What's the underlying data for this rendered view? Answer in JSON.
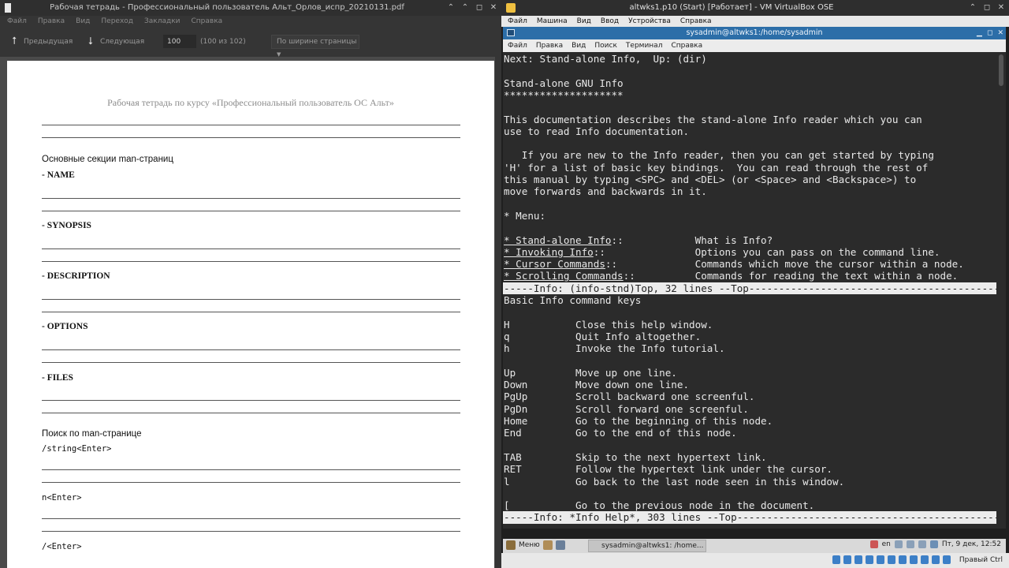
{
  "pdf": {
    "title": "Рабочая тетрадь - Профессиональный пользователь Альт_Орлов_испр_20210131.pdf",
    "menu": [
      "Файл",
      "Правка",
      "Вид",
      "Переход",
      "Закладки",
      "Справка"
    ],
    "toolbar": {
      "prev_label": "Предыдущая",
      "next_label": "Следующая",
      "page_value": "100",
      "page_count": "(100 из 102)",
      "zoom": "По ширине страницы"
    },
    "page": {
      "header": "Рабочая тетрадь по курсу «Профессиональный пользователь ОС Альт»",
      "section_title": "Основные секции man-страниц",
      "items": [
        "- NAME",
        "- SYNOPSIS",
        "- DESCRIPTION",
        "- OPTIONS",
        "- FILES"
      ],
      "search_title": "Поиск по man-странице",
      "search_items": [
        "/string<Enter>",
        "n<Enter>",
        "/<Enter>"
      ]
    }
  },
  "vbox": {
    "title": "altwks1.p10 (Start) [Работает] - VM VirtualBox OSE",
    "menu": [
      "Файл",
      "Машина",
      "Вид",
      "Ввод",
      "Устройства",
      "Справка"
    ],
    "terminal": {
      "title": "sysadmin@altwks1:/home/sysadmin",
      "menu": [
        "Файл",
        "Правка",
        "Вид",
        "Поиск",
        "Терминал",
        "Справка"
      ],
      "top_lines": [
        "Next: Stand-alone Info,  Up: (dir)",
        "",
        "Stand-alone GNU Info",
        "********************",
        "",
        "This documentation describes the stand-alone Info reader which you can",
        "use to read Info documentation.",
        "",
        "   If you are new to the Info reader, then you can get started by typing",
        "'H' for a list of basic key bindings.  You can read through the rest of",
        "this manual by typing <SPC> and <DEL> (or <Space> and <Backspace>) to",
        "move forwards and backwards in it.",
        "",
        "* Menu:",
        ""
      ],
      "menu_entries": [
        {
          "link": "* Stand-alone Info",
          "sep": "::            ",
          "desc": "What is Info?"
        },
        {
          "link": "* Invoking Info",
          "sep": "::               ",
          "desc": "Options you can pass on the command line."
        },
        {
          "link": "* Cursor Commands",
          "sep": "::             ",
          "desc": "Commands which move the cursor within a node."
        },
        {
          "link": "* Scrolling Commands",
          "sep": "::          ",
          "desc": "Commands for reading the text within a node."
        }
      ],
      "status1": "-----Info: (info-stnd)Top, 32 lines --Top---------------------------------------------",
      "bottom_lines": [
        "Basic Info command keys",
        "",
        "H           Close this help window.",
        "q           Quit Info altogether.",
        "h           Invoke the Info tutorial.",
        "",
        "Up          Move up one line.",
        "Down        Move down one line.",
        "PgUp        Scroll backward one screenful.",
        "PgDn        Scroll forward one screenful.",
        "Home        Go to the beginning of this node.",
        "End         Go to the end of this node.",
        "",
        "TAB         Skip to the next hypertext link.",
        "RET         Follow the hypertext link under the cursor.",
        "l           Go back to the last node seen in this window.",
        "",
        "[           Go to the previous node in the document."
      ],
      "status2": "-----Info: *Info Help*, 303 lines --Top--------------------------------------------------"
    },
    "taskbar": {
      "menu_label": "Меню",
      "task_label": "sysadmin@altwks1: /home...",
      "lang": "en",
      "clock": "Пт, 9 дек, 12:52"
    },
    "host_key": "Правый Ctrl"
  }
}
